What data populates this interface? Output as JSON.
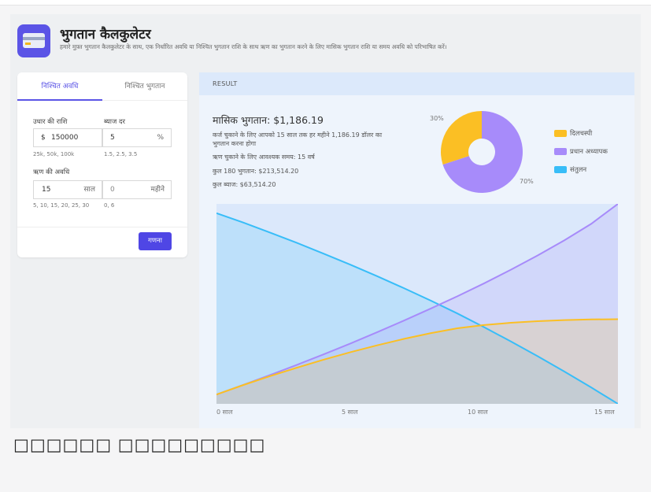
{
  "header": {
    "title": "भुगतान कैलकुलेटर",
    "subtitle": "हमारे मुफ़्त भुगतान कैलकुलेटर के साथ, एक निर्धारित अवधि या निश्चित भुगतान राशि के साथ ऋण का भुगतान करने के लिए मासिक भुगतान राशि या समय अवधि को परिभाषित करें।"
  },
  "form": {
    "tabs": [
      "निश्चित अवधि",
      "निश्चित भुगतान"
    ],
    "loan_label": "उधार की राशि",
    "loan_prefix": "$",
    "loan_value": "150000",
    "loan_hint": "25k, 50k, 100k",
    "rate_label": "ब्याज दर",
    "rate_value": "5",
    "rate_suffix": "%",
    "rate_hint": "1.5, 2.5, 3.5",
    "term_label": "ऋण की अवधि",
    "years_value": "15",
    "years_unit": "साल",
    "years_hint": "5, 10, 15, 20, 25, 30",
    "months_value": "0",
    "months_unit": "महीने",
    "months_hint": "0, 6",
    "calc_button": "गणना"
  },
  "result": {
    "header": "RESULT",
    "monthly": "मासिक भुगतान: $1,186.19",
    "line1": "कर्ज चुकाने के लिए आपको 15 साल तक हर महीने 1,186.19 डॉलर का भुगतान करना होगा",
    "line2": "ऋण चुकाने के लिए आवश्यक समय: 15 वर्ष",
    "line3": "कुल 180 भुगतान: $213,514.20",
    "line4": "कुल ब्याज: $63,514.20"
  },
  "legend": {
    "interest": "दिलचस्पी",
    "principal": "प्रधान अध्यापक",
    "balance": "संतुलन"
  },
  "colors": {
    "interest": "#fbbf24",
    "principal": "#a78bfa",
    "balance": "#38bdf8",
    "accent": "#4f46e5"
  },
  "chart_data": [
    {
      "type": "pie",
      "categories": [
        "दिलचस्पी",
        "प्रधान अध्यापक"
      ],
      "values": [
        30,
        70
      ],
      "labels": [
        "30%",
        "70%"
      ]
    },
    {
      "type": "area",
      "x": [
        0,
        1,
        2,
        3,
        4,
        5,
        6,
        7,
        8,
        9,
        10,
        11,
        12,
        13,
        14,
        15
      ],
      "tick_labels": [
        "0 साल",
        "5 साल",
        "10 साल",
        "15 साल"
      ],
      "tick_values": [
        0,
        5,
        10,
        15
      ],
      "ylim": [
        0,
        150000
      ],
      "series": [
        {
          "name": "दिलचस्पी",
          "values": [
            7000,
            14100,
            20800,
            27100,
            33100,
            38700,
            43900,
            48700,
            53000,
            56700,
            59100,
            60800,
            62000,
            62800,
            63300,
            63514
          ]
        },
        {
          "name": "प्रधान अध्यापक",
          "values": [
            7000,
            14200,
            21600,
            29200,
            37100,
            45200,
            53700,
            62400,
            71400,
            80700,
            90400,
            100600,
            111300,
            122700,
            135000,
            150000
          ]
        },
        {
          "name": "संतुलन",
          "values": [
            143000,
            136000,
            128500,
            120800,
            112700,
            104400,
            95800,
            86800,
            77500,
            67800,
            57500,
            46800,
            35700,
            24200,
            12300,
            0
          ]
        }
      ]
    }
  ],
  "footer_text": "□□□□□□ □□□□□□□□□"
}
